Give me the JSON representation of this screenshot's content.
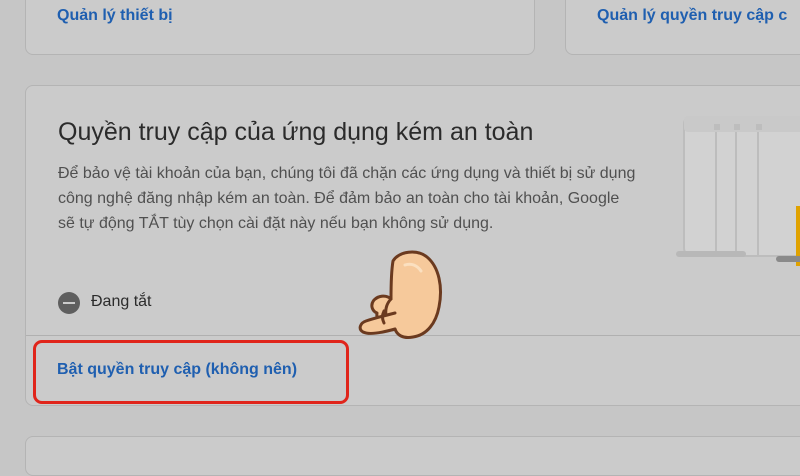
{
  "top_cards": {
    "left_link": "Quản lý thiết bị",
    "right_link": "Quản lý quyền truy cập c"
  },
  "section": {
    "title": "Quyền truy cập của ứng dụng kém an toàn",
    "description": "Để bảo vệ tài khoản của bạn, chúng tôi đã chặn các ứng dụng và thiết bị sử dụng công nghệ đăng nhập kém an toàn. Để đảm bảo an toàn cho tài khoản, Google sẽ tự động TẮT tùy chọn cài đặt này nếu bạn không sử dụng.",
    "status": "Đang tắt",
    "enable_link": "Bật quyền truy cập (không nên)"
  },
  "icons": {
    "status": "minus-circle-icon",
    "pointer": "pointing-hand-icon"
  },
  "colors": {
    "link": "#1f5fb0",
    "highlight_border": "#e0251b",
    "background": "#c6c6c6"
  }
}
